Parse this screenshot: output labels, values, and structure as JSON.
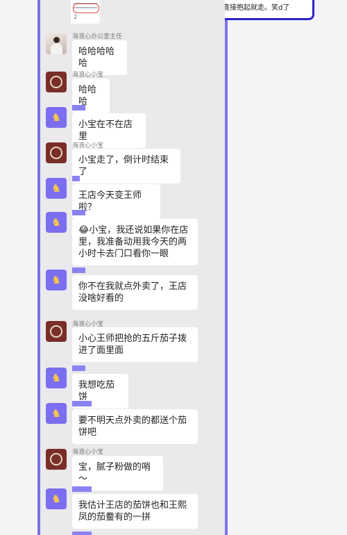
{
  "notification": {
    "line1": "",
    "line2": "直接抱起就走。笑d了"
  },
  "previous_snippet": {
    "number": "2"
  },
  "messages": [
    {
      "sender": "海浪心办公室主任",
      "text": "哈哈哈哈哈",
      "avatar": "photo-avatar"
    },
    {
      "sender": "海浪心小宝",
      "text": "哈哈哈",
      "avatar": "brown-logo-avatar"
    },
    {
      "sender": "",
      "text": "小宝在不在店里",
      "avatar": "purple-horse-avatar"
    },
    {
      "sender": "海浪心小宝",
      "text": "小宝走了，倒计时结束了",
      "avatar": "brown-logo-avatar"
    },
    {
      "sender": "",
      "text": "王店今天变王师啦？",
      "avatar": "purple-horse-avatar"
    },
    {
      "sender": "",
      "text": "😂小宝，我还说如果你在店里，我准备动用我今天的两小时卡去门口看你一眼",
      "avatar": "purple-horse-avatar"
    },
    {
      "sender": "",
      "text": "你不在我就点外卖了，王店没啥好看的",
      "avatar": "purple-horse-avatar"
    },
    {
      "sender": "海浪心小宝",
      "text": "小心王师把抢的五斤茄子拨进了面里面",
      "avatar": "brown-logo-avatar"
    },
    {
      "sender": "",
      "text": "我想吃茄饼",
      "avatar": "purple-horse-avatar"
    },
    {
      "sender": "",
      "text": "要不明天点外卖的都送个茄饼吧",
      "avatar": "purple-horse-avatar"
    },
    {
      "sender": "海浪心小宝",
      "text": "宝，腻子粉做的哨～",
      "avatar": "brown-logo-avatar"
    },
    {
      "sender": "",
      "text": "我估计王店的茄饼也和王熙凤的茄鲞有的一拼",
      "avatar": "purple-horse-avatar"
    }
  ],
  "colors": {
    "accent_bar": "#7c72e8",
    "hidden_name_bar": "#8b82f2",
    "notification_border": "#2b22c9",
    "bubble": "#ffffff",
    "panel": "#eaeaec"
  }
}
